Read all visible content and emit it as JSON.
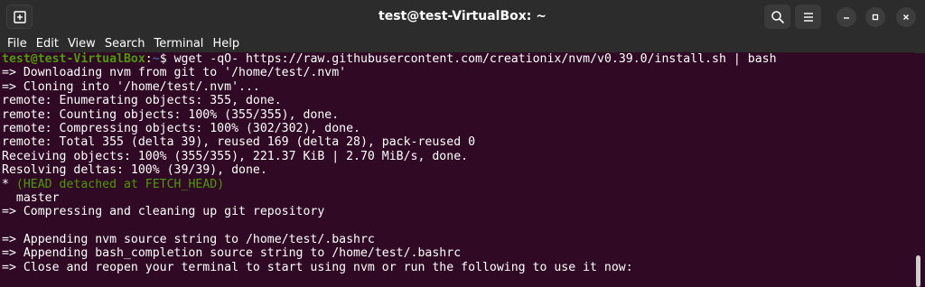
{
  "window": {
    "title": "test@test-VirtualBox: ~"
  },
  "menu": [
    "File",
    "Edit",
    "View",
    "Search",
    "Terminal",
    "Help"
  ],
  "icons": {
    "new_tab": "new-tab-icon",
    "search": "search-icon",
    "menu": "hamburger-menu-icon",
    "minimize": "minimize-icon",
    "maximize": "maximize-icon",
    "close": "close-icon"
  },
  "colors": {
    "terminal_bg": "#300a24",
    "prompt_user": "#4e9a06",
    "prompt_path": "#3465a4",
    "head_detached": "#4e9a06"
  },
  "prompt": {
    "user_host": "test@test-VirtualBox",
    "sep": ":",
    "path": "~",
    "symbol": "$ ",
    "command": "wget -qO- https://raw.githubusercontent.com/creationix/nvm/v0.39.0/install.sh | bash"
  },
  "output": [
    "=> Downloading nvm from git to '/home/test/.nvm'",
    "=> Cloning into '/home/test/.nvm'...",
    "remote: Enumerating objects: 355, done.",
    "remote: Counting objects: 100% (355/355), done.",
    "remote: Compressing objects: 100% (302/302), done.",
    "remote: Total 355 (delta 39), reused 169 (delta 28), pack-reused 0",
    "Receiving objects: 100% (355/355), 221.37 KiB | 2.70 MiB/s, done.",
    "Resolving deltas: 100% (39/39), done."
  ],
  "head_line": {
    "star": "* ",
    "text": "(HEAD detached at FETCH_HEAD)"
  },
  "branch_line": "  master",
  "output2": [
    "=> Compressing and cleaning up git repository",
    "",
    "=> Appending nvm source string to /home/test/.bashrc",
    "=> Appending bash_completion source string to /home/test/.bashrc",
    "=> Close and reopen your terminal to start using nvm or run the following to use it now:"
  ]
}
